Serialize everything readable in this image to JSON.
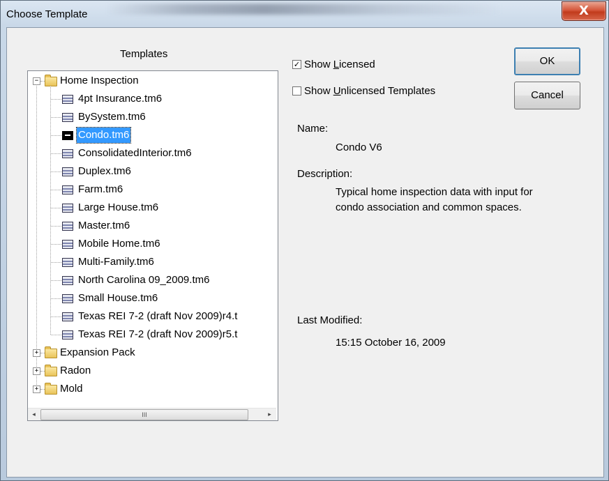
{
  "window": {
    "title": "Choose Template",
    "close_glyph": "X"
  },
  "templates_label": "Templates",
  "tree": {
    "home": "Home Inspection",
    "files": [
      "4pt Insurance.tm6",
      "BySystem.tm6",
      "Condo.tm6",
      "ConsolidatedInterior.tm6",
      "Duplex.tm6",
      "Farm.tm6",
      "Large House.tm6",
      "Master.tm6",
      "Mobile Home.tm6",
      "Multi-Family.tm6",
      "North Carolina 09_2009.tm6",
      "Small House.tm6",
      "Texas REI 7-2 (draft Nov 2009)r4.t",
      "Texas REI 7-2 (draft Nov 2009)r5.t"
    ],
    "selected_index": 2,
    "folders": [
      "Expansion Pack",
      "Radon",
      "Mold"
    ],
    "collapse_glyph": "−",
    "expand_glyph": "+"
  },
  "scrollbar": {
    "left_glyph": "◂",
    "right_glyph": "▸",
    "thumb_grip": "III"
  },
  "options": {
    "show_licensed": {
      "checked": true,
      "pre": "Show ",
      "key": "L",
      "post": "icensed"
    },
    "show_unlicensed": {
      "checked": false,
      "pre": "Show ",
      "key": "U",
      "post": "nlicensed Templates"
    },
    "check_glyph": "✓"
  },
  "buttons": {
    "ok": "OK",
    "cancel": "Cancel"
  },
  "details": {
    "name_label": "Name:",
    "name_value": "Condo V6",
    "description_label": "Description:",
    "description_line1": "Typical home inspection data with input for",
    "description_line2": "condo association and common spaces.",
    "modified_label": "Last Modified:",
    "modified_value": "15:15 October 16, 2009"
  }
}
